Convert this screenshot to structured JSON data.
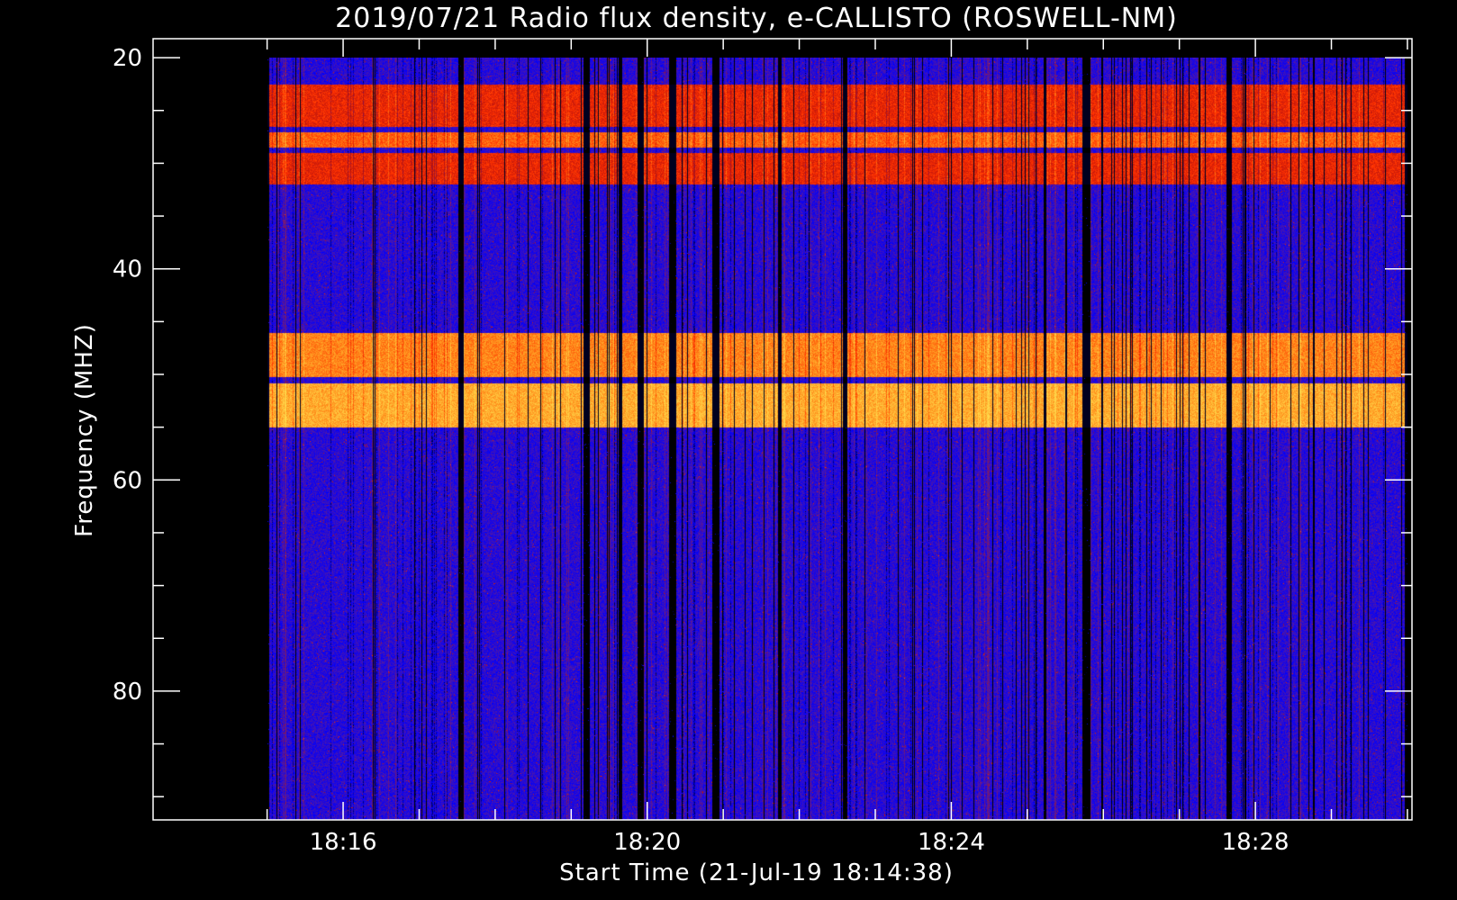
{
  "chart_data": {
    "type": "heatmap",
    "title": "2019/07/21  Radio flux density, e-CALLISTO (ROSWELL-NM)",
    "xlabel": "Start Time (21-Jul-19 18:14:38)",
    "ylabel": "Frequency (MHZ)",
    "x_tick_labels": [
      "18:16",
      "18:20",
      "18:24",
      "18:28"
    ],
    "x_tick_values_min": [
      16,
      20,
      24,
      28
    ],
    "x_minor_tick_values_min": [
      15,
      16,
      17,
      18,
      19,
      20,
      21,
      22,
      23,
      24,
      25,
      26,
      27,
      28,
      29,
      30
    ],
    "y_tick_labels": [
      "20",
      "40",
      "60",
      "80"
    ],
    "y_tick_values": [
      20,
      40,
      60,
      80
    ],
    "y_minor_tick_values": [
      20,
      25,
      30,
      35,
      40,
      45,
      50,
      55,
      60,
      65,
      70,
      75,
      80,
      85,
      90
    ],
    "xlim_min": [
      13.5,
      30.06
    ],
    "ylim": [
      92.2,
      18.2
    ],
    "data_xrange_min": [
      15,
      30
    ],
    "data_yrange": [
      20,
      92.2
    ],
    "y_axis_inverted": true,
    "colormap": [
      "#000000",
      "#0000ff",
      "#5a1a9a",
      "#b01010",
      "#ff3000",
      "#ff8c1a",
      "#ffd84a"
    ],
    "intensity_bands_mhz": [
      {
        "from": 22.5,
        "to": 26.5,
        "level": 0.62
      },
      {
        "from": 27,
        "to": 28.5,
        "level": 0.75
      },
      {
        "from": 29,
        "to": 32,
        "level": 0.62
      },
      {
        "from": 46,
        "to": 50.2,
        "level": 0.82
      },
      {
        "from": 50.8,
        "to": 55,
        "level": 0.9
      }
    ],
    "grid": false,
    "colors": {
      "background": "#000000",
      "axes": "#ffffff"
    }
  }
}
